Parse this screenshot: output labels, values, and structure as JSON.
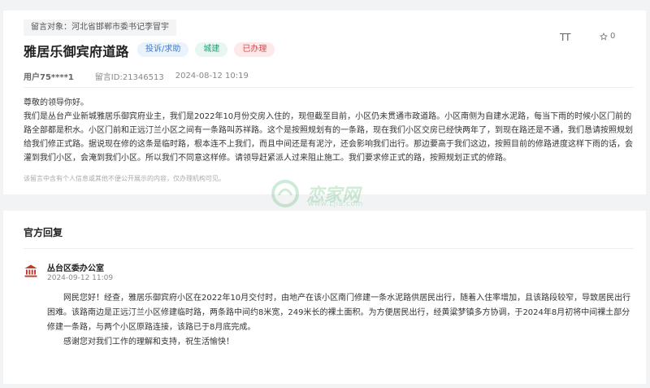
{
  "message": {
    "target_label": "留言对象：河北省邯郸市委书记李冒宇",
    "title": "雅居乐御宾府道路",
    "tags": [
      "投诉/求助",
      "城建",
      "已办理"
    ],
    "font_size_icon": "TT",
    "favorite_count": "0",
    "user": "用户75****1",
    "message_id": "留言ID:21346513",
    "datetime": "2024-08-12 10:19",
    "greeting": "尊敬的领导你好。",
    "body": "我们是丛台产业新城雅居乐御宾府业主，我们是2022年10月份交房入住的，现但截至目前，小区仍未贯通市政道路。小区南侧为自建水泥路，每当下雨的时候小区门前的路全部都是积水。小区门前和正远汀兰小区之间有一条路叫苏祥路。这个是按照规划有的一条路，现在我们小区交房已经快两年了，到现在路还是不通，我们恳请按照规划给我们修正式路。据说现在修的这条是临时路，根本连不上我们，而且中间还是有泥泞，还会影响我们出行。那边要高于我们这边，按照目前的修路进度这样下雨的话，会灌到我们小区，会淹到我们小区。所以我们不同意这样修。请领导赶紧派人过来阻止施工。我们要求修正式的路，按照规划正式的修路。",
    "notice": "该留言中含有个人信息或其他不便公开展示的内容，仅办理机构可见。"
  },
  "watermark": {
    "text": "恋家网",
    "url": "www.Ljia.com"
  },
  "reply": {
    "section_title": "官方回复",
    "org_name": "丛台区委办公室",
    "date": "2024-09-12 11:09",
    "paragraph1": "网民您好！经查，雅居乐御宾府小区在2022年10月交付时，由地产在该小区南门修建一条水泥路供居民出行，随着入住率增加，且该路段较窄，导致居民出行困难。该路南边是正远汀兰小区修建临时路，两条路中间约8米宽，249米长的裸土面积。为方便居民出行，经黄粱梦镇多方协调，于2024年8月初将中间裸土部分修建一条路，与两个小区原路连接，该路已于8月底完成。",
    "paragraph2": "感谢您对我们工作的理解和支持，祝生活愉快！"
  },
  "colors": {
    "page_bg": "#f2f3f5",
    "tag_blue": "#3a7bd5",
    "tag_green": "#2a9d74",
    "tag_red": "#d84a4a",
    "org_icon": "#c0392b"
  },
  "icons": {
    "font_size": "font-size-icon",
    "favorite": "star-icon",
    "organization": "government-building-icon"
  }
}
